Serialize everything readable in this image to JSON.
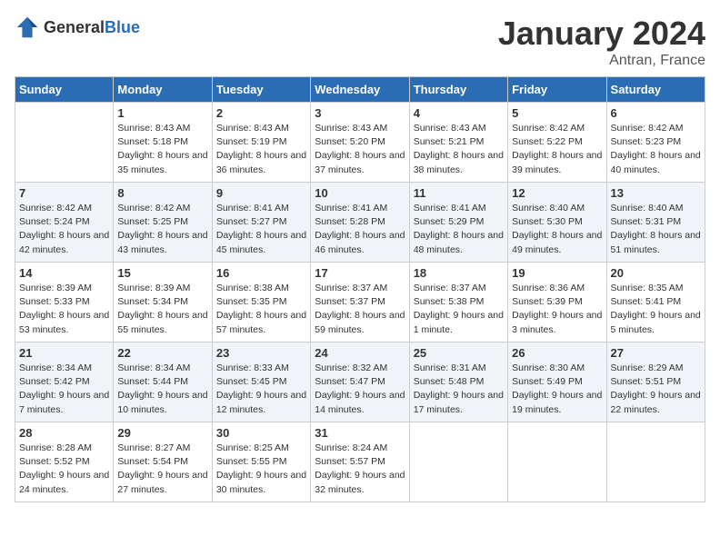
{
  "header": {
    "logo_general": "General",
    "logo_blue": "Blue",
    "title": "January 2024",
    "subtitle": "Antran, France"
  },
  "days_of_week": [
    "Sunday",
    "Monday",
    "Tuesday",
    "Wednesday",
    "Thursday",
    "Friday",
    "Saturday"
  ],
  "weeks": [
    [
      {
        "day": "",
        "sunrise": "",
        "sunset": "",
        "daylight": ""
      },
      {
        "day": "1",
        "sunrise": "Sunrise: 8:43 AM",
        "sunset": "Sunset: 5:18 PM",
        "daylight": "Daylight: 8 hours and 35 minutes."
      },
      {
        "day": "2",
        "sunrise": "Sunrise: 8:43 AM",
        "sunset": "Sunset: 5:19 PM",
        "daylight": "Daylight: 8 hours and 36 minutes."
      },
      {
        "day": "3",
        "sunrise": "Sunrise: 8:43 AM",
        "sunset": "Sunset: 5:20 PM",
        "daylight": "Daylight: 8 hours and 37 minutes."
      },
      {
        "day": "4",
        "sunrise": "Sunrise: 8:43 AM",
        "sunset": "Sunset: 5:21 PM",
        "daylight": "Daylight: 8 hours and 38 minutes."
      },
      {
        "day": "5",
        "sunrise": "Sunrise: 8:42 AM",
        "sunset": "Sunset: 5:22 PM",
        "daylight": "Daylight: 8 hours and 39 minutes."
      },
      {
        "day": "6",
        "sunrise": "Sunrise: 8:42 AM",
        "sunset": "Sunset: 5:23 PM",
        "daylight": "Daylight: 8 hours and 40 minutes."
      }
    ],
    [
      {
        "day": "7",
        "sunrise": "Sunrise: 8:42 AM",
        "sunset": "Sunset: 5:24 PM",
        "daylight": "Daylight: 8 hours and 42 minutes."
      },
      {
        "day": "8",
        "sunrise": "Sunrise: 8:42 AM",
        "sunset": "Sunset: 5:25 PM",
        "daylight": "Daylight: 8 hours and 43 minutes."
      },
      {
        "day": "9",
        "sunrise": "Sunrise: 8:41 AM",
        "sunset": "Sunset: 5:27 PM",
        "daylight": "Daylight: 8 hours and 45 minutes."
      },
      {
        "day": "10",
        "sunrise": "Sunrise: 8:41 AM",
        "sunset": "Sunset: 5:28 PM",
        "daylight": "Daylight: 8 hours and 46 minutes."
      },
      {
        "day": "11",
        "sunrise": "Sunrise: 8:41 AM",
        "sunset": "Sunset: 5:29 PM",
        "daylight": "Daylight: 8 hours and 48 minutes."
      },
      {
        "day": "12",
        "sunrise": "Sunrise: 8:40 AM",
        "sunset": "Sunset: 5:30 PM",
        "daylight": "Daylight: 8 hours and 49 minutes."
      },
      {
        "day": "13",
        "sunrise": "Sunrise: 8:40 AM",
        "sunset": "Sunset: 5:31 PM",
        "daylight": "Daylight: 8 hours and 51 minutes."
      }
    ],
    [
      {
        "day": "14",
        "sunrise": "Sunrise: 8:39 AM",
        "sunset": "Sunset: 5:33 PM",
        "daylight": "Daylight: 8 hours and 53 minutes."
      },
      {
        "day": "15",
        "sunrise": "Sunrise: 8:39 AM",
        "sunset": "Sunset: 5:34 PM",
        "daylight": "Daylight: 8 hours and 55 minutes."
      },
      {
        "day": "16",
        "sunrise": "Sunrise: 8:38 AM",
        "sunset": "Sunset: 5:35 PM",
        "daylight": "Daylight: 8 hours and 57 minutes."
      },
      {
        "day": "17",
        "sunrise": "Sunrise: 8:37 AM",
        "sunset": "Sunset: 5:37 PM",
        "daylight": "Daylight: 8 hours and 59 minutes."
      },
      {
        "day": "18",
        "sunrise": "Sunrise: 8:37 AM",
        "sunset": "Sunset: 5:38 PM",
        "daylight": "Daylight: 9 hours and 1 minute."
      },
      {
        "day": "19",
        "sunrise": "Sunrise: 8:36 AM",
        "sunset": "Sunset: 5:39 PM",
        "daylight": "Daylight: 9 hours and 3 minutes."
      },
      {
        "day": "20",
        "sunrise": "Sunrise: 8:35 AM",
        "sunset": "Sunset: 5:41 PM",
        "daylight": "Daylight: 9 hours and 5 minutes."
      }
    ],
    [
      {
        "day": "21",
        "sunrise": "Sunrise: 8:34 AM",
        "sunset": "Sunset: 5:42 PM",
        "daylight": "Daylight: 9 hours and 7 minutes."
      },
      {
        "day": "22",
        "sunrise": "Sunrise: 8:34 AM",
        "sunset": "Sunset: 5:44 PM",
        "daylight": "Daylight: 9 hours and 10 minutes."
      },
      {
        "day": "23",
        "sunrise": "Sunrise: 8:33 AM",
        "sunset": "Sunset: 5:45 PM",
        "daylight": "Daylight: 9 hours and 12 minutes."
      },
      {
        "day": "24",
        "sunrise": "Sunrise: 8:32 AM",
        "sunset": "Sunset: 5:47 PM",
        "daylight": "Daylight: 9 hours and 14 minutes."
      },
      {
        "day": "25",
        "sunrise": "Sunrise: 8:31 AM",
        "sunset": "Sunset: 5:48 PM",
        "daylight": "Daylight: 9 hours and 17 minutes."
      },
      {
        "day": "26",
        "sunrise": "Sunrise: 8:30 AM",
        "sunset": "Sunset: 5:49 PM",
        "daylight": "Daylight: 9 hours and 19 minutes."
      },
      {
        "day": "27",
        "sunrise": "Sunrise: 8:29 AM",
        "sunset": "Sunset: 5:51 PM",
        "daylight": "Daylight: 9 hours and 22 minutes."
      }
    ],
    [
      {
        "day": "28",
        "sunrise": "Sunrise: 8:28 AM",
        "sunset": "Sunset: 5:52 PM",
        "daylight": "Daylight: 9 hours and 24 minutes."
      },
      {
        "day": "29",
        "sunrise": "Sunrise: 8:27 AM",
        "sunset": "Sunset: 5:54 PM",
        "daylight": "Daylight: 9 hours and 27 minutes."
      },
      {
        "day": "30",
        "sunrise": "Sunrise: 8:25 AM",
        "sunset": "Sunset: 5:55 PM",
        "daylight": "Daylight: 9 hours and 30 minutes."
      },
      {
        "day": "31",
        "sunrise": "Sunrise: 8:24 AM",
        "sunset": "Sunset: 5:57 PM",
        "daylight": "Daylight: 9 hours and 32 minutes."
      },
      {
        "day": "",
        "sunrise": "",
        "sunset": "",
        "daylight": ""
      },
      {
        "day": "",
        "sunrise": "",
        "sunset": "",
        "daylight": ""
      },
      {
        "day": "",
        "sunrise": "",
        "sunset": "",
        "daylight": ""
      }
    ]
  ]
}
